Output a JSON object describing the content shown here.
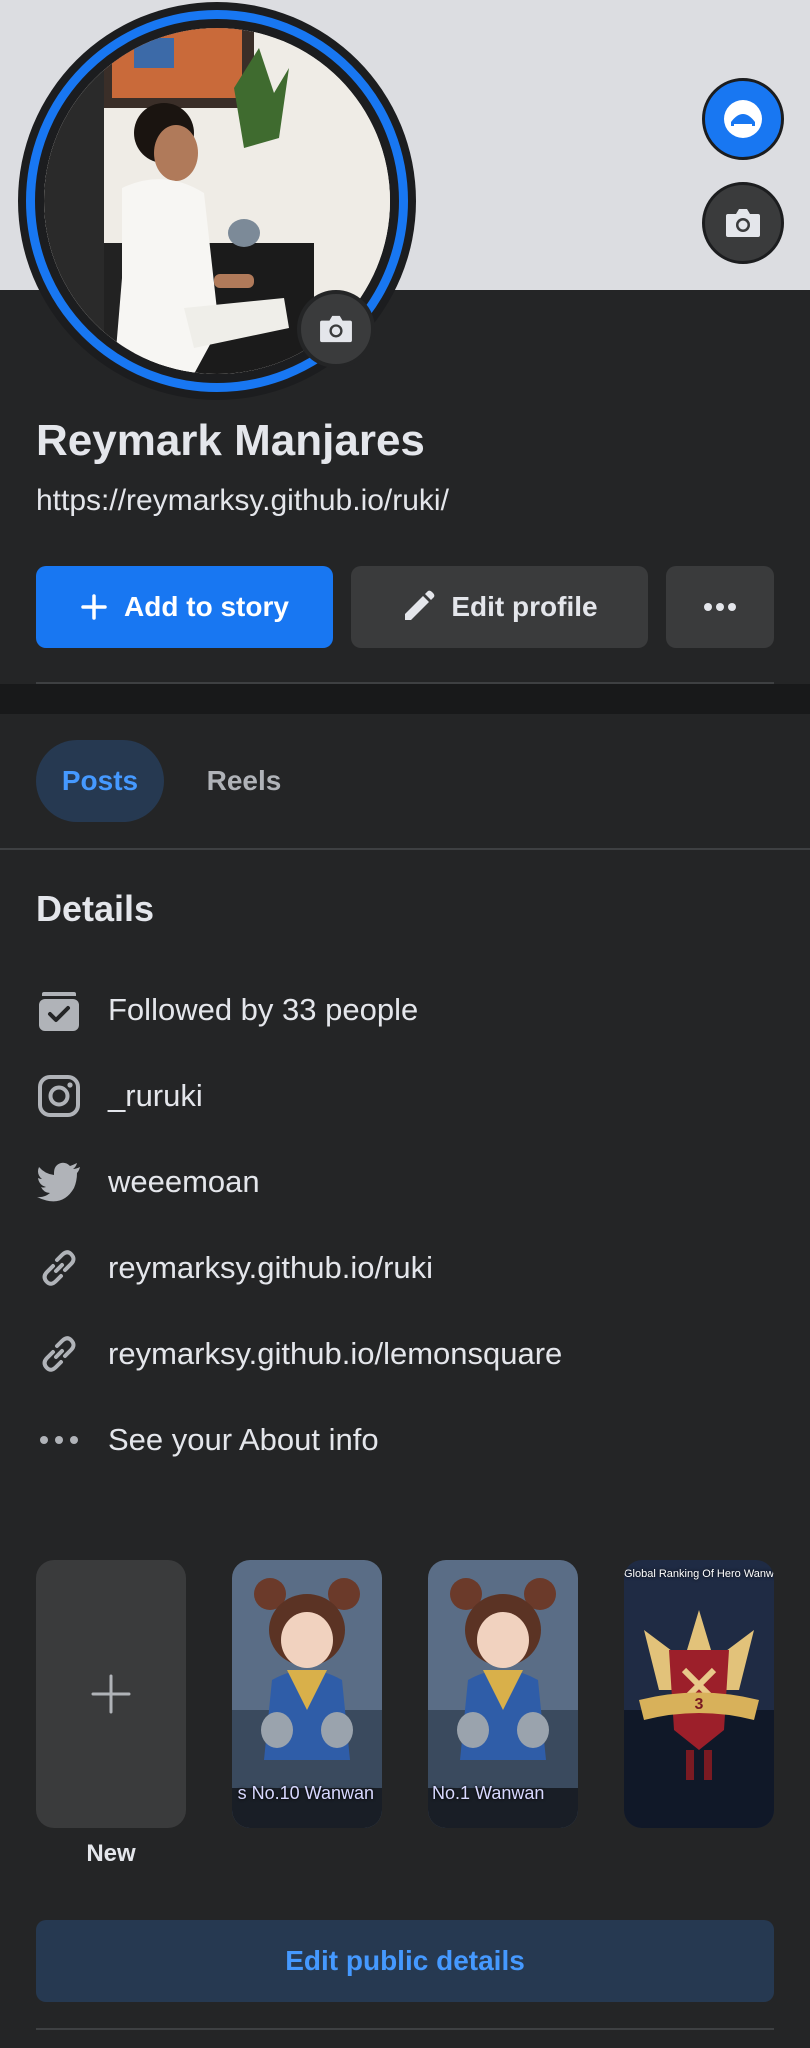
{
  "profile": {
    "name": "Reymark Manjares",
    "bio_url": "https://reymarksy.github.io/ruki/"
  },
  "actions": {
    "add_story": "Add to story",
    "edit_profile": "Edit profile"
  },
  "tabs": [
    {
      "label": "Posts",
      "active": true
    },
    {
      "label": "Reels",
      "active": false
    }
  ],
  "details": {
    "title": "Details",
    "items": [
      {
        "icon": "followers-icon",
        "text": "Followed by 33 people"
      },
      {
        "icon": "instagram-icon",
        "text": "_ruruki"
      },
      {
        "icon": "twitter-icon",
        "text": "weeemoan"
      },
      {
        "icon": "link-icon",
        "text": "reymarksy.github.io/ruki"
      },
      {
        "icon": "link-icon",
        "text": "reymarksy.github.io/lemonsquare"
      },
      {
        "icon": "more-dots-icon",
        "text": "See your About info"
      }
    ]
  },
  "featured": {
    "new_label": "New",
    "stories": [
      {
        "caption": "s No.10 Wanwan"
      },
      {
        "caption": "No.1 Wanwan"
      },
      {
        "caption": "Global Ranking Of Hero Wanwan",
        "badge": "3"
      }
    ]
  },
  "edit_public_details": "Edit public details",
  "colors": {
    "accent": "#1877f2",
    "background": "#242526",
    "secondary_button": "#3a3b3c",
    "tab_active_bg": "#263951",
    "tab_active_text": "#4599ff"
  }
}
